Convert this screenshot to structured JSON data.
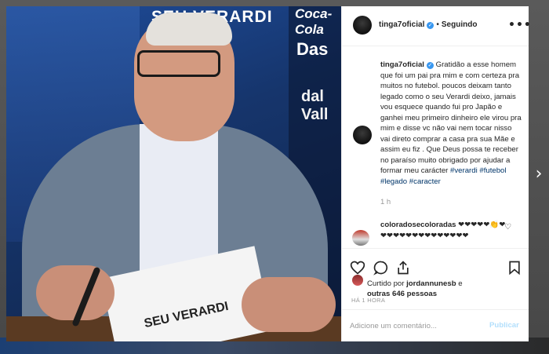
{
  "photo": {
    "banner_1": "SEU VERARDI",
    "banner_2": "Coca-Cola",
    "banner_3": "Das",
    "banner_4": "dal Vall",
    "book_title": "SEU VERARDI"
  },
  "header": {
    "username": "tinga7oficial",
    "separator": "•",
    "follow_status": "Seguindo",
    "more_icon": "more-horizontal-icon"
  },
  "caption": {
    "username": "tinga7oficial",
    "text": " Gratidão a esse homem que foi um pai pra mim e com certeza pra muitos no futebol. poucos deixam tanto legado como o seu Verardi deixo, jamais vou esquece quando fui pro Japão e ganhei meu primeiro dinheiro ele virou pra mim e disse vc não vai nem tocar nisso vai direto comprar a casa pra sua Mãe e assim eu fiz . Que Deus possa te receber no paraíso muito obrigado por ajudar a formar meu carácter ",
    "hashtags": "#verardi #futebol #legado #caracter",
    "time_ago": "1 h"
  },
  "comment": {
    "username": "coloradosecoloradas",
    "text": " ❤❤❤❤❤👏❤ ❤❤❤❤❤❤❤❤❤❤❤❤❤❤"
  },
  "actions": {
    "like_icon": "heart-icon",
    "comment_icon": "comment-icon",
    "share_icon": "share-icon",
    "save_icon": "bookmark-icon"
  },
  "likes": {
    "prefix": "Curtido por ",
    "user": "jordannunesb",
    "middle": " e",
    "others": "outras 646 pessoas"
  },
  "post_date": "HÁ 1 HORA",
  "add_comment": {
    "placeholder": "Adicione um comentário...",
    "publish_label": "Publicar"
  },
  "nav": {
    "next_arrow": "›"
  },
  "colors": {
    "link": "#003569",
    "publish_disabled": "#b2dffc",
    "verified": "#3897f0"
  }
}
